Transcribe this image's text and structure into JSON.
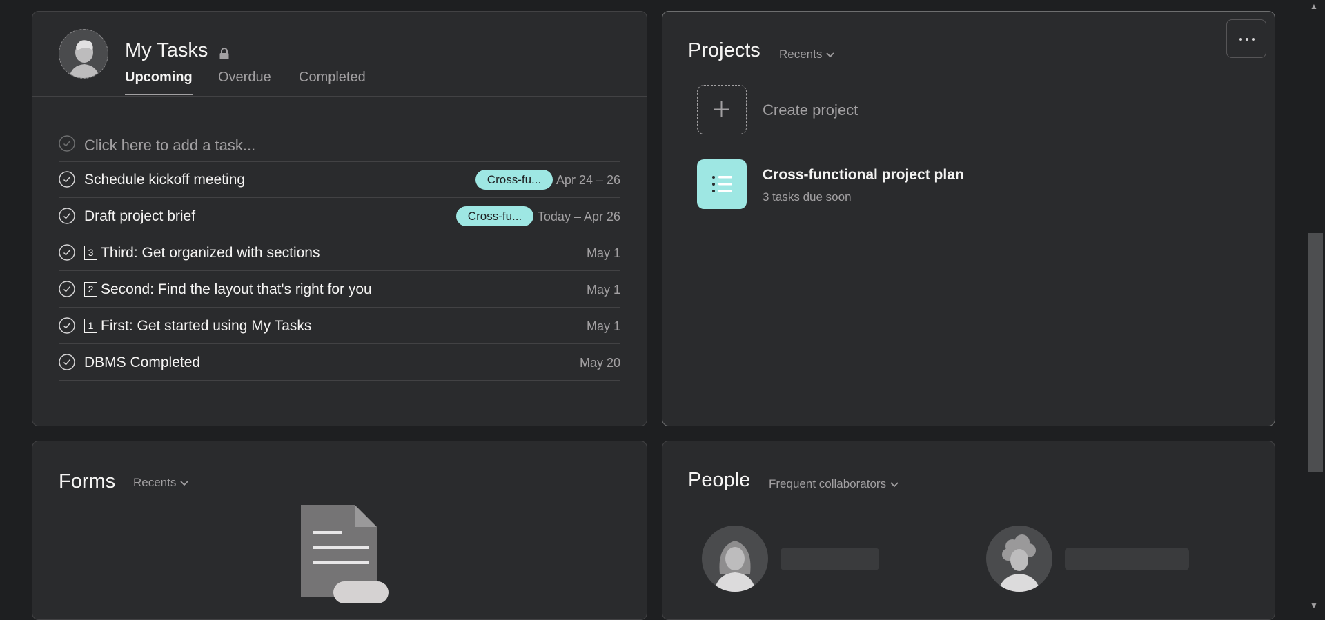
{
  "my_tasks": {
    "title": "My Tasks",
    "tabs": [
      {
        "label": "Upcoming",
        "active": true
      },
      {
        "label": "Overdue",
        "active": false
      },
      {
        "label": "Completed",
        "active": false
      }
    ],
    "add_task_placeholder": "Click here to add a task...",
    "tasks": [
      {
        "number": "",
        "name": "Schedule kickoff meeting",
        "project_tag": "Cross-fu...",
        "date": "Apr 24 – 26"
      },
      {
        "number": "",
        "name": "Draft project brief",
        "project_tag": "Cross-fu...",
        "date": "Today – Apr 26"
      },
      {
        "number": "3",
        "name": "Third: Get organized with sections",
        "project_tag": "",
        "date": "May 1"
      },
      {
        "number": "2",
        "name": "Second: Find the layout that's right for you",
        "project_tag": "",
        "date": "May 1"
      },
      {
        "number": "1",
        "name": "First: Get started using My Tasks",
        "project_tag": "",
        "date": "May 1"
      },
      {
        "number": "",
        "name": "DBMS Completed",
        "project_tag": "",
        "date": "May 20"
      }
    ]
  },
  "projects": {
    "title": "Projects",
    "filter": "Recents",
    "create_label": "Create project",
    "items": [
      {
        "name": "Cross-functional project plan",
        "subtitle": "3 tasks due soon"
      }
    ]
  },
  "forms": {
    "title": "Forms",
    "filter": "Recents"
  },
  "people": {
    "title": "People",
    "filter": "Frequent collaborators"
  },
  "colors": {
    "background": "#1e1f21",
    "card": "#2a2b2d",
    "accent_teal": "#9ee7e3",
    "muted_text": "#a2a0a2"
  },
  "icons": [
    "user-avatar-icon",
    "lock-icon",
    "check-circle-icon",
    "chevron-down-icon",
    "more-horizontal-icon",
    "plus-icon",
    "list-icon",
    "form-document-icon"
  ]
}
